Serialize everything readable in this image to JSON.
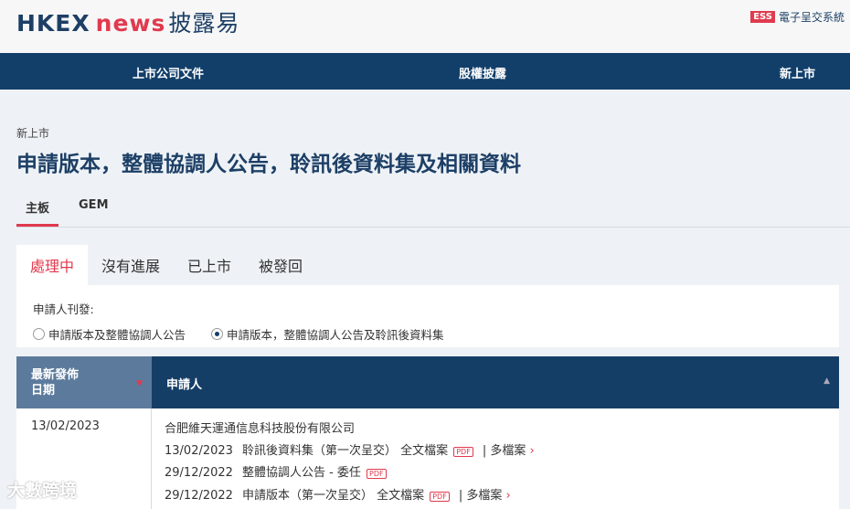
{
  "header": {
    "logo_main": "HKEX",
    "logo_news": "news",
    "logo_cn": "披露易",
    "ess_badge": "ESS",
    "ess_label": "電子呈交系統"
  },
  "nav": [
    "上市公司文件",
    "股權披露",
    "新上市"
  ],
  "breadcrumb": "新上市",
  "title": "申請版本，整體協調人公告，聆訊後資料集及相關資料",
  "main_tabs": [
    "主板",
    "GEM"
  ],
  "status_tabs": [
    "處理中",
    "沒有進展",
    "已上市",
    "被發回"
  ],
  "filter": {
    "label": "申請人刊發:",
    "options": [
      "申請版本及整體協調人公告",
      "申請版本，整體協調人公告及聆訊後資料集"
    ],
    "selected": 1
  },
  "table": {
    "headers": [
      "最新發佈日期",
      "申請人"
    ],
    "header_line1": "最新發佈",
    "header_line2": "日期",
    "rows": [
      {
        "date": "13/02/2023",
        "applicant": "合肥維天運通信息科技股份有限公司",
        "docs": [
          {
            "date": "13/02/2023",
            "title": "聆訊後資料集（第一次呈交） 全文檔案",
            "pdf": "PDF",
            "more": "| 多檔案"
          },
          {
            "date": "29/12/2022",
            "title": "整體協調人公告 - 委任",
            "pdf": "PDF",
            "more": ""
          },
          {
            "date": "29/12/2022",
            "title": "申請版本（第一次呈交） 全文檔案",
            "pdf": "PDF",
            "more": "| 多檔案"
          }
        ]
      }
    ]
  },
  "watermark": "大數跨境",
  "colors": {
    "navy": "#123f6a",
    "red": "#e03a4e"
  }
}
